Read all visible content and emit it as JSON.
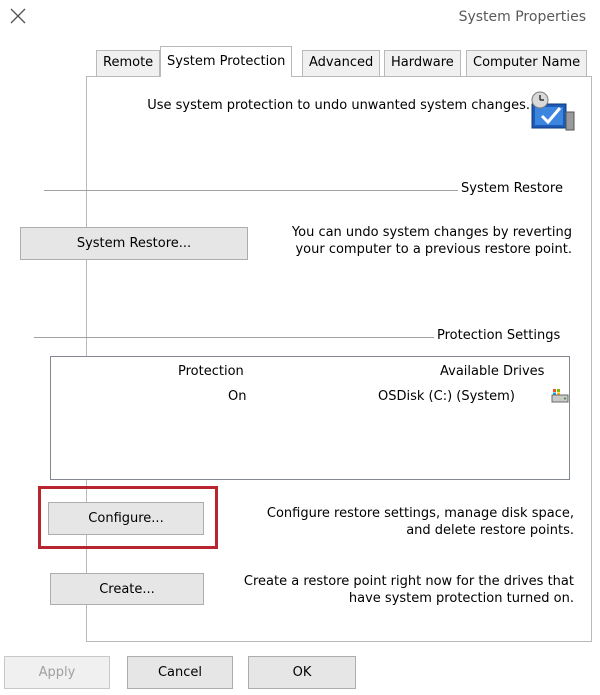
{
  "window": {
    "title": "System Properties",
    "close_icon": "close-icon"
  },
  "tabs": [
    {
      "label": "Computer Name",
      "active": false
    },
    {
      "label": "Hardware",
      "active": false
    },
    {
      "label": "Advanced",
      "active": false
    },
    {
      "label": "System Protection",
      "active": true
    },
    {
      "label": "Remote",
      "active": false
    }
  ],
  "intro": {
    "text": "Use system protection to undo unwanted system changes.",
    "icon": "system-protection-icon"
  },
  "system_restore": {
    "group_label": "System Restore",
    "description_line1": "You can undo system changes by reverting",
    "description_line2": "your computer to a previous restore point.",
    "button_label": "System Restore..."
  },
  "protection_settings": {
    "group_label": "Protection Settings",
    "columns": {
      "drives": "Available Drives",
      "protection": "Protection"
    },
    "drives": [
      {
        "name": "OSDisk (C:) (System)",
        "protection": "On",
        "icon": "drive-icon"
      }
    ],
    "configure": {
      "description_line1": "Configure restore settings, manage disk space,",
      "description_line2": "and delete restore points.",
      "button_label": "Configure..."
    },
    "create": {
      "description_line1": "Create a restore point right now for the drives that",
      "description_line2": "have system protection turned on.",
      "button_label": "Create..."
    }
  },
  "footer": {
    "ok_label": "OK",
    "cancel_label": "Cancel",
    "apply_label": "Apply"
  },
  "colors": {
    "highlight": "#b8252f",
    "button_bg": "#e6e6e6",
    "panel_border": "#b9b9b9"
  }
}
